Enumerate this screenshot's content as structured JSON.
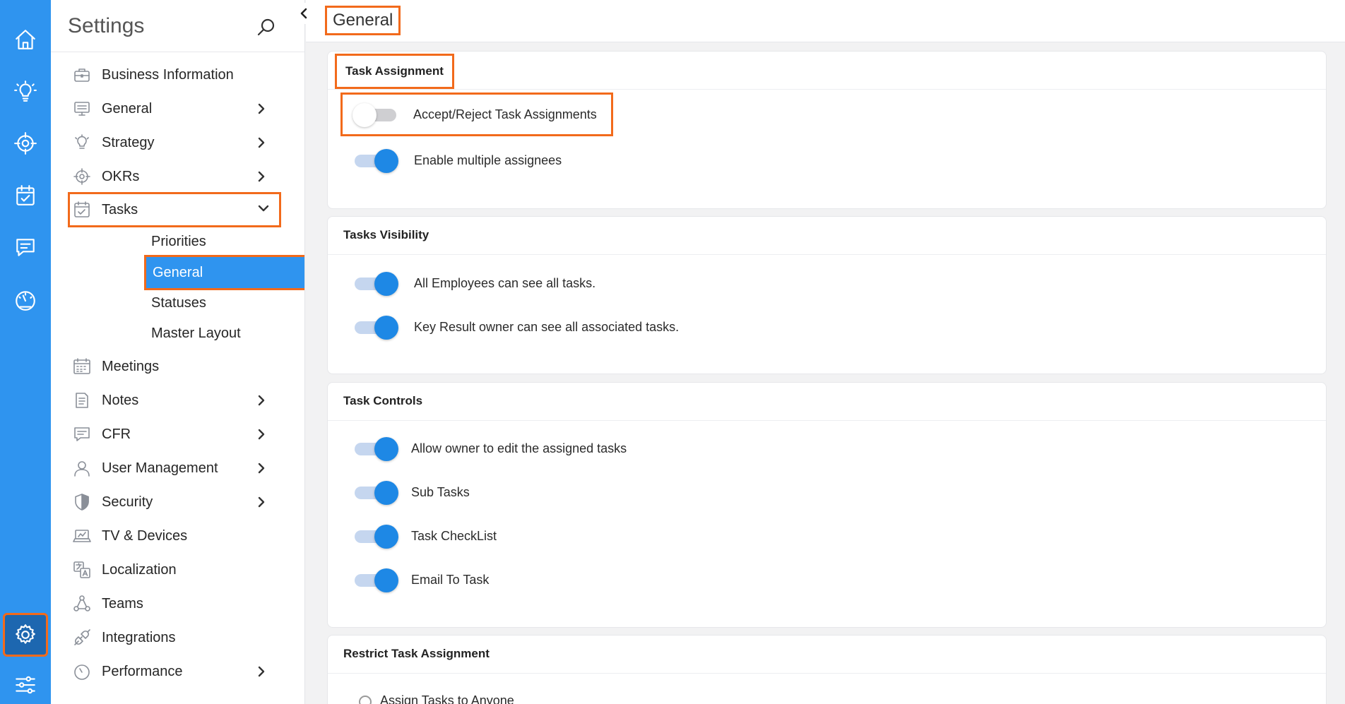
{
  "rail": {
    "items": [
      {
        "name": "home-icon"
      },
      {
        "name": "lightbulb-icon"
      },
      {
        "name": "target-icon"
      },
      {
        "name": "calendar-check-icon"
      },
      {
        "name": "chat-icon"
      },
      {
        "name": "gauge-icon"
      },
      {
        "name": "gear-icon",
        "active": true
      },
      {
        "name": "sliders-icon"
      }
    ]
  },
  "sidebar": {
    "title": "Settings",
    "items": [
      {
        "label": "Business Information",
        "icon": "briefcase-icon",
        "chevron": false
      },
      {
        "label": "General",
        "icon": "monitor-settings-icon",
        "chevron": true
      },
      {
        "label": "Strategy",
        "icon": "lightbulb-icon",
        "chevron": true
      },
      {
        "label": "OKRs",
        "icon": "target-icon",
        "chevron": true
      },
      {
        "label": "Tasks",
        "icon": "calendar-check-icon",
        "chevron": "down"
      },
      {
        "label": "Meetings",
        "icon": "calendar-grid-icon",
        "chevron": false
      },
      {
        "label": "Notes",
        "icon": "note-icon",
        "chevron": true
      },
      {
        "label": "CFR",
        "icon": "chat-icon",
        "chevron": true
      },
      {
        "label": "User Management",
        "icon": "user-icon",
        "chevron": true
      },
      {
        "label": "Security",
        "icon": "shield-icon",
        "chevron": true
      },
      {
        "label": "TV & Devices",
        "icon": "laptop-icon",
        "chevron": false
      },
      {
        "label": "Localization",
        "icon": "translate-icon",
        "chevron": false
      },
      {
        "label": "Teams",
        "icon": "teams-icon",
        "chevron": false
      },
      {
        "label": "Integrations",
        "icon": "plug-icon",
        "chevron": false
      },
      {
        "label": "Performance",
        "icon": "gauge-icon",
        "chevron": true
      }
    ],
    "task_subitems": [
      {
        "label": "Priorities"
      },
      {
        "label": "General",
        "active": true
      },
      {
        "label": "Statuses"
      },
      {
        "label": "Master Layout"
      }
    ]
  },
  "header": {
    "title": "General"
  },
  "sections": {
    "task_assignment": {
      "title": "Task Assignment",
      "rows": [
        {
          "label": "Accept/Reject Task Assignments",
          "on": false
        },
        {
          "label": "Enable multiple assignees",
          "on": true
        }
      ]
    },
    "tasks_visibility": {
      "title": "Tasks Visibility",
      "rows": [
        {
          "label": "All Employees can see all tasks.",
          "on": true
        },
        {
          "label": "Key Result owner can see all associated tasks.",
          "on": true
        }
      ]
    },
    "task_controls": {
      "title": "Task Controls",
      "rows": [
        {
          "label": "Allow owner to edit the assigned tasks",
          "on": true
        },
        {
          "label": "Sub Tasks",
          "on": true
        },
        {
          "label": "Task CheckList",
          "on": true
        },
        {
          "label": "Email To Task",
          "on": true
        }
      ]
    },
    "restrict_task_assignment": {
      "title": "Restrict Task Assignment",
      "first_option": "Assign Tasks to Anyone"
    }
  },
  "colors": {
    "rail": "#2f94ef",
    "accent": "#1e88e5",
    "highlight": "#f26a1b"
  }
}
